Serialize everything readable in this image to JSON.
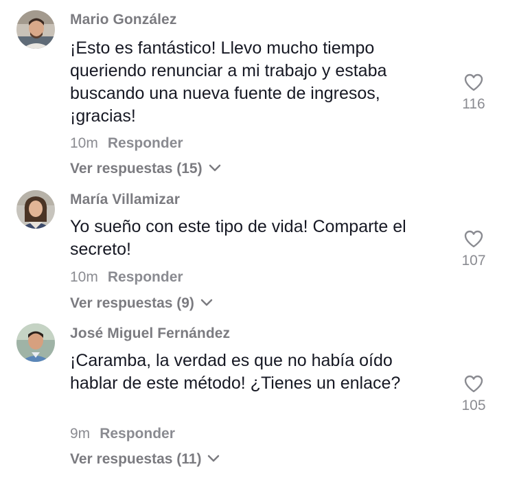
{
  "comments": [
    {
      "username": "Mario González",
      "text": "¡Esto es fantástico! Llevo mucho tiempo queriendo renunciar a mi trabajo y estaba buscando una nueva fuente de ingresos, ¡gracias!",
      "time": "10m",
      "reply_label": "Responder",
      "view_replies": "Ver respuestas (15)",
      "likes": "116",
      "avatar_icon": "user-avatar"
    },
    {
      "username": "María Villamizar",
      "text": "Yo sueño con este tipo de vida! Comparte el secreto!",
      "time": "10m",
      "reply_label": "Responder",
      "view_replies": "Ver respuestas (9)",
      "likes": "107",
      "avatar_icon": "user-avatar"
    },
    {
      "username": "José Miguel Fernández",
      "text": "¡Caramba, la verdad es que no había oído hablar de este método! ¿Tienes un enlace?",
      "time": "9m",
      "reply_label": "Responder",
      "view_replies": "Ver respuestas (11)",
      "likes": "105",
      "avatar_icon": "user-avatar"
    }
  ],
  "colors": {
    "text_primary": "#161823",
    "text_secondary": "#8a8b91",
    "username": "#7b7b80",
    "heart_outline": "#8a8b91"
  }
}
